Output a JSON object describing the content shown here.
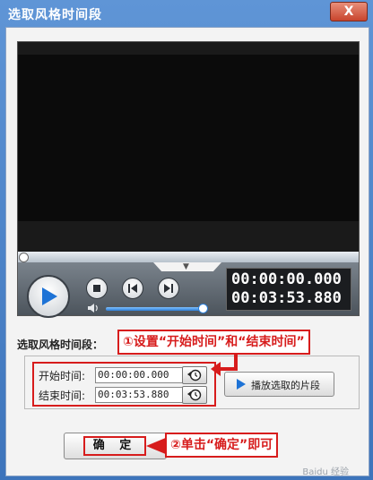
{
  "window": {
    "title": "选取风格时间段",
    "close_label": "X"
  },
  "player": {
    "current_time": "00:00:00.000",
    "total_time": "00:03:53.880",
    "seek_fraction": 0.0,
    "volume_fraction": 1.0
  },
  "segment": {
    "section_label": "选取风格时间段：",
    "start_label": "开始时间:",
    "start_value": "00:00:00.000",
    "end_label": "结束时间:",
    "end_value": "00:03:53.880",
    "play_segment_label": "播放选取的片段"
  },
  "footer": {
    "ok_label": "确 定"
  },
  "annotations": {
    "callout_1": "①设置“开始时间”和“结束时间”",
    "callout_2": "②单击“确定”即可"
  },
  "watermark": "Baidu 经验",
  "colors": {
    "title_bar": "#4a7ebf",
    "annotation_red": "#d71c1c",
    "accent_blue": "#2d7fd8"
  }
}
